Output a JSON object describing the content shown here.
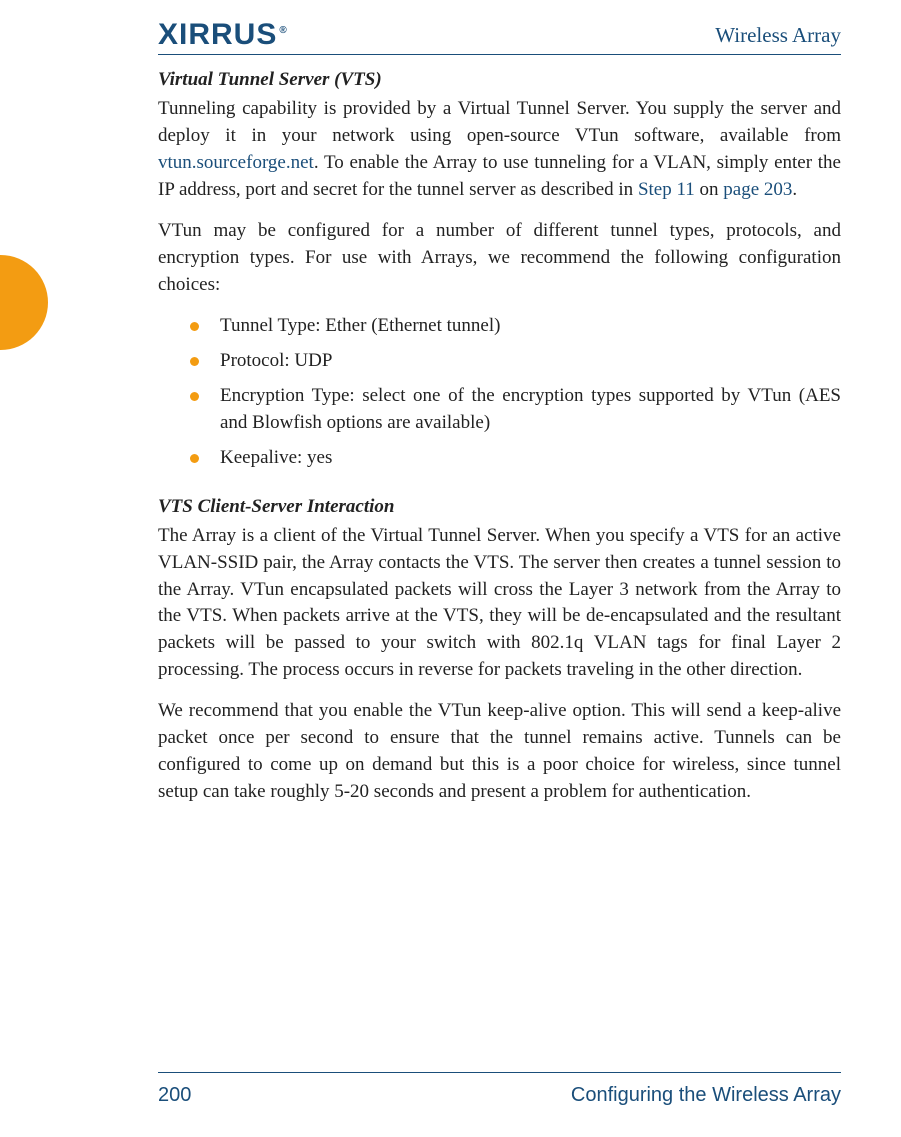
{
  "header": {
    "logo_text": "XIRRUS",
    "product": "Wireless Array"
  },
  "section1": {
    "title": "Virtual Tunnel Server (VTS)",
    "p1_a": "Tunneling capability is provided by a Virtual Tunnel Server. You supply the server and deploy it in your network using open-source VTun software, available from ",
    "p1_link1": "vtun.sourceforge.net",
    "p1_b": ". To enable the Array to use tunneling for a VLAN, simply enter the IP address, port and secret for the tunnel server as described in ",
    "p1_link2": "Step 11",
    "p1_c": " on ",
    "p1_link3": "page 203",
    "p1_d": ".",
    "p2": "VTun may be configured for a number of different tunnel types, protocols, and encryption types. For use with Arrays, we recommend the following configuration choices:",
    "bullets": [
      "Tunnel Type: Ether (Ethernet tunnel)",
      "Protocol: UDP",
      "Encryption Type: select one of the encryption types supported by VTun (AES and Blowfish options are available)",
      "Keepalive: yes"
    ]
  },
  "section2": {
    "title": "VTS Client-Server Interaction",
    "p1": "The Array is a client of the Virtual Tunnel Server. When you specify a VTS for an active VLAN-SSID pair, the Array contacts the VTS. The server then creates a tunnel session to the Array. VTun encapsulated packets will cross the Layer 3 network from the Array to the VTS. When packets arrive at the VTS, they will be de-encapsulated and the resultant packets will be passed to your switch with 802.1q VLAN tags for final Layer 2 processing. The process occurs in reverse for packets traveling in the other direction.",
    "p2": "We recommend that you enable the VTun keep-alive option. This will send a keep-alive packet once per second to ensure that the tunnel remains active. Tunnels can be configured to come up on demand but this is a poor choice for wireless, since tunnel setup can take roughly 5-20 seconds and present a problem for authentication."
  },
  "footer": {
    "page": "200",
    "chapter": "Configuring the Wireless Array"
  }
}
